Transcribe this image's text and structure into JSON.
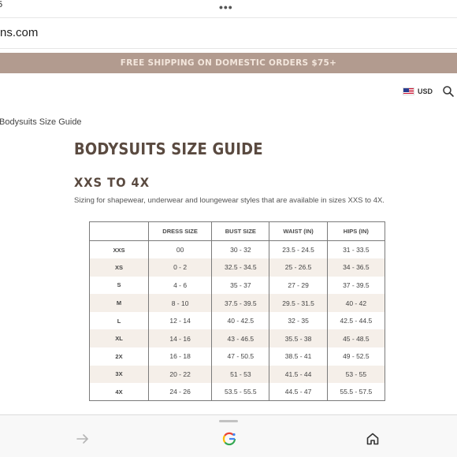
{
  "browser": {
    "status_fragment": "5",
    "more_dots": "•••",
    "url": "ns.com"
  },
  "promo": {
    "text": "FREE SHIPPING ON DOMESTIC ORDERS $75+"
  },
  "header": {
    "currency": "USD",
    "flag_icon": "us-flag-icon",
    "search_icon": "search-icon"
  },
  "breadcrumb": "Bodysuits Size Guide",
  "page": {
    "title": "BODYSUITS SIZE GUIDE",
    "section_title": "XXS TO 4X",
    "section_description": "Sizing for shapewear, underwear and loungewear styles that are available in sizes XXS to 4X."
  },
  "size_table": {
    "headers": [
      "",
      "DRESS SIZE",
      "BUST SIZE",
      "WAIST (IN)",
      "HIPS (IN)"
    ],
    "rows": [
      [
        "XXS",
        "00",
        "30 - 32",
        "23.5 - 24.5",
        "31 - 33.5"
      ],
      [
        "XS",
        "0 - 2",
        "32.5 - 34.5",
        "25 - 26.5",
        "34 - 36.5"
      ],
      [
        "S",
        "4 - 6",
        "35 - 37",
        "27 - 29",
        "37 - 39.5"
      ],
      [
        "M",
        "8 - 10",
        "37.5 - 39.5",
        "29.5 - 31.5",
        "40 - 42"
      ],
      [
        "L",
        "12 - 14",
        "40 - 42.5",
        "32 - 35",
        "42.5 - 44.5"
      ],
      [
        "XL",
        "14 - 16",
        "43 - 46.5",
        "35.5 - 38",
        "45 - 48.5"
      ],
      [
        "2X",
        "16 - 18",
        "47 - 50.5",
        "38.5 - 41",
        "49 - 52.5"
      ],
      [
        "3X",
        "20 - 22",
        "51 - 53",
        "41.5 - 44",
        "53 - 55"
      ],
      [
        "4X",
        "24 - 26",
        "53.5 - 55.5",
        "44.5 - 47",
        "55.5 - 57.5"
      ]
    ]
  },
  "bottom_bar": {
    "forward_icon": "arrow-right-icon",
    "google_icon": "google-g-icon",
    "home_icon": "home-icon"
  },
  "colors": {
    "promo_bg": "#b29b8f",
    "heading": "#5a4a40",
    "row_alt": "#f5efe9"
  }
}
